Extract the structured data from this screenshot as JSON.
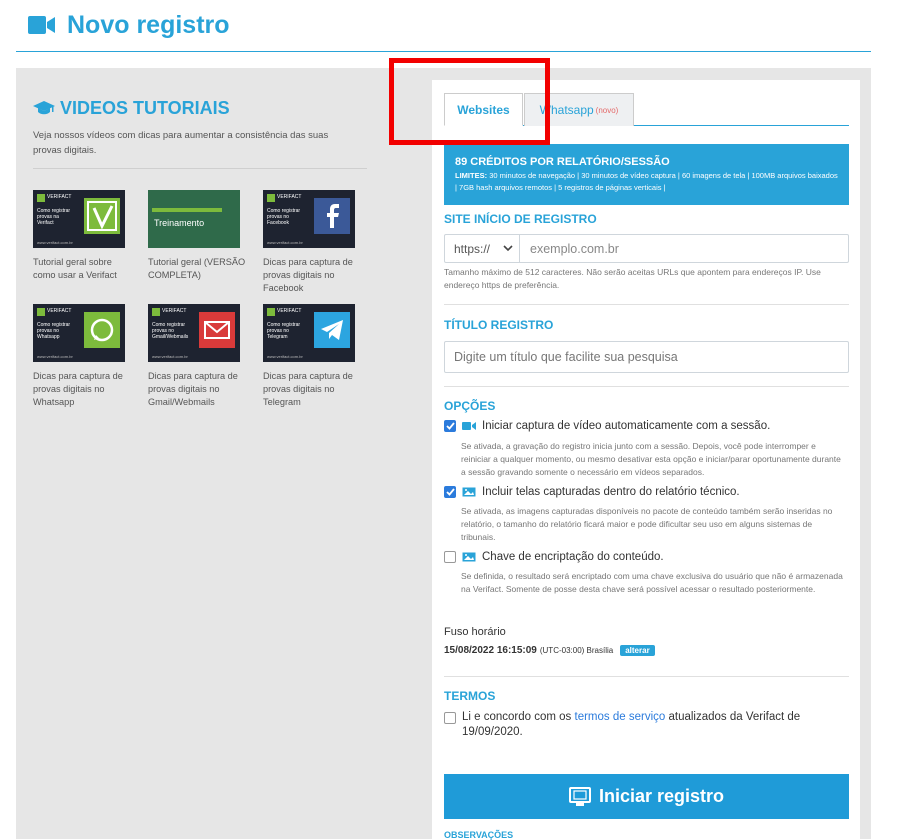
{
  "header": {
    "title": "Novo registro"
  },
  "tutorials": {
    "title": "VIDEOS TUTORIAIS",
    "intro": "Veja nossos vídeos com dicas para aumentar a consistência das suas provas digitais.",
    "videos": [
      {
        "thumb_brand": "VERIFACT",
        "thumb_title": "Como registrar provas na Verifact",
        "thumb_url": "www.verifact.com.br",
        "icon": "verifact-logo-icon",
        "caption": "Tutorial geral sobre como usar a Verifact"
      },
      {
        "thumb_brand": "",
        "thumb_title": "Treinamento",
        "thumb_url": "",
        "icon": "training-icon",
        "caption": "Tutorial geral (VERSÃO COMPLETA)"
      },
      {
        "thumb_brand": "VERIFACT",
        "thumb_title": "Como registrar provas no Facebook",
        "thumb_url": "www.verifact.com.br",
        "icon": "facebook-icon",
        "caption": "Dicas para captura de provas digitais no Facebook"
      },
      {
        "thumb_brand": "VERIFACT",
        "thumb_title": "Como registrar provas no Whatsapp",
        "thumb_url": "www.verifact.com.br",
        "icon": "whatsapp-icon",
        "caption": "Dicas para captura de provas digitais no Whatsapp"
      },
      {
        "thumb_brand": "VERIFACT",
        "thumb_title": "Como registrar provas no Gmail/Webmails",
        "thumb_url": "www.verifact.com.br",
        "icon": "gmail-icon",
        "caption": "Dicas para captura de provas digitais no Gmail/Webmails"
      },
      {
        "thumb_brand": "VERIFACT",
        "thumb_title": "Como registrar provas no Telegram",
        "thumb_url": "www.verifact.com.br",
        "icon": "telegram-icon",
        "caption": "Dicas para captura de provas digitais no Telegram"
      }
    ]
  },
  "tabs": {
    "websites": "Websites",
    "whatsapp": "Whatsapp",
    "whatsapp_badge": "(novo)"
  },
  "credits": {
    "title": "89 CRÉDITOS POR RELATÓRIO/SESSÃO",
    "limits_label": "LIMITES:",
    "limits_text": "30 minutos de navegação | 30 minutos de vídeo captura | 60 imagens de tela | 100MB arquivos baixados | 7GB hash arquivos remotos | 5 registros de páginas verticais |"
  },
  "site": {
    "label": "SITE INÍCIO DE REGISTRO",
    "protocol": "https://",
    "placeholder": "exemplo.com.br",
    "hint": "Tamanho máximo de 512 caracteres. Não serão aceitas URLs que apontem para endereços IP. Use endereço https de preferência."
  },
  "title_field": {
    "label": "TÍTULO REGISTRO",
    "placeholder": "Digite um título que facilite sua pesquisa"
  },
  "options": {
    "label": "OPÇÕES",
    "items": [
      {
        "checked": true,
        "icon": "video-camera-icon",
        "text": "Iniciar captura de vídeo automaticamente com a sessão.",
        "desc": "Se ativada, a gravação do registro inicia junto com a sessão. Depois, você pode interromper e reiniciar a qualquer momento, ou mesmo desativar esta opção e iniciar/parar oportunamente durante a sessão gravando somente o necessário em vídeos separados."
      },
      {
        "checked": true,
        "icon": "image-icon",
        "text": "Incluir telas capturadas dentro do relatório técnico.",
        "desc": "Se ativada, as imagens capturadas disponíveis no pacote de conteúdo também serão inseridas no relatório, o tamanho do relatório ficará maior e pode dificultar seu uso em alguns sistemas de tribunais."
      },
      {
        "checked": false,
        "icon": "image-icon",
        "text": "Chave de encriptação do conteúdo.",
        "desc": "Se definida, o resultado será encriptado com uma chave exclusiva do usuário que não é armazenada na Verifact. Somente de posse desta chave será possível acessar o resultado posteriormente."
      }
    ]
  },
  "timezone": {
    "label": "Fuso horário",
    "datetime": "15/08/2022 16:15:09",
    "zone": "(UTC-03:00) Brasília",
    "change": "alterar"
  },
  "terms": {
    "label": "TERMOS",
    "text_before": "Li e concordo com os ",
    "link": "termos de serviço",
    "text_after": " atualizados da Verifact de 19/09/2020."
  },
  "start_button": "Iniciar registro",
  "observations_label": "OBSERVAÇÕES",
  "colors": {
    "accent": "#29a3d8",
    "highlight": "#f20000"
  }
}
